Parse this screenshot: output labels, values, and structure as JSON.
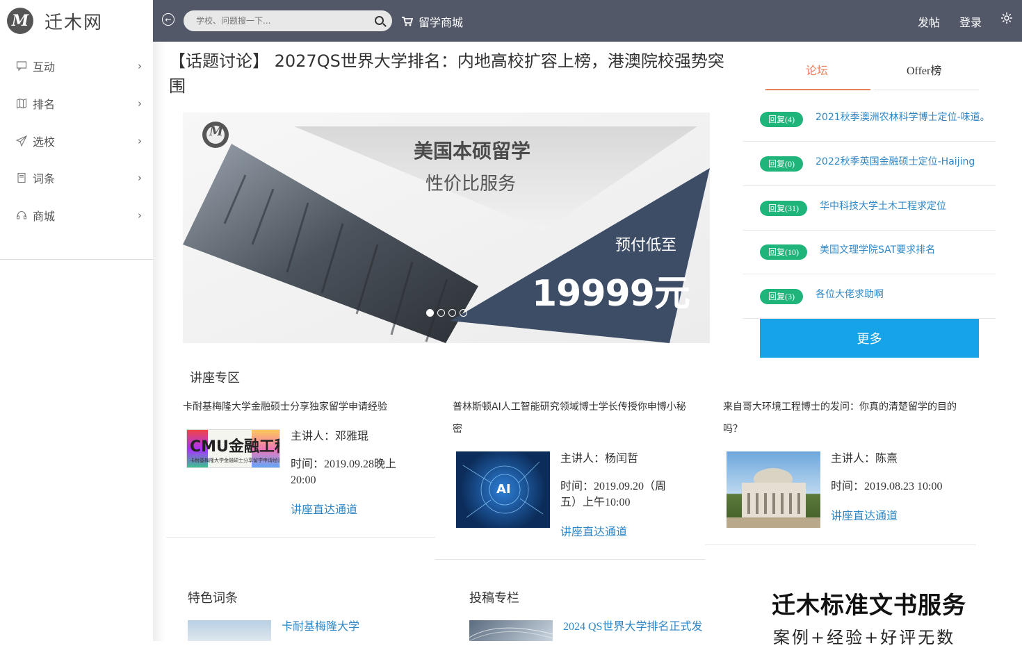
{
  "brand": {
    "logo_letter": "M",
    "name": "迁木网"
  },
  "sidebar": {
    "items": [
      {
        "label": "互动",
        "icon": "chat-icon"
      },
      {
        "label": "排名",
        "icon": "map-icon"
      },
      {
        "label": "选校",
        "icon": "send-icon"
      },
      {
        "label": "词条",
        "icon": "book-icon"
      },
      {
        "label": "商城",
        "icon": "headset-icon"
      }
    ],
    "arrow": "›"
  },
  "topbar": {
    "search_placeholder": "学校、问题搜一下...",
    "shop_label": "留学商城",
    "post_label": "发帖",
    "login_label": "登录"
  },
  "article": {
    "title": "【话题讨论】 2027QS世界大学排名：内地高校扩容上榜，港澳院校强势突围"
  },
  "banner": {
    "logo_letter": "M",
    "headline": "美国本硕留学",
    "subhead": "性价比服务",
    "price_label": "预付低至",
    "price": "19999元",
    "slides": 4,
    "active_slide": 1
  },
  "lectures": {
    "section_title": "讲座专区",
    "items": [
      {
        "title": "卡耐基梅隆大学金融硕士分享独家留学申请经验",
        "image_text": "CMU金融工程",
        "image_caption": "卡耐基梅隆大学金融硕士分享留学申请经验",
        "speaker": "主讲人：邓雅琨",
        "time": "时间：2019.09.28晚上20:00",
        "link": "讲座直达通道"
      },
      {
        "title": "普林斯顿AI人工智能研究领域博士学长传授你申博小秘密",
        "image_text": "AI",
        "speaker": "主讲人：杨闰哲",
        "time": "时间：2019.09.20（周五）上午10:00",
        "link": "讲座直达通道"
      },
      {
        "title": "来自哥大环境工程博士的发问：你真的清楚留学的目的吗？",
        "speaker": "主讲人：陈熹",
        "time": "时间：2019.08.23 10:00",
        "link": "讲座直达通道"
      }
    ]
  },
  "forum": {
    "tabs": [
      "论坛",
      "Offer榜"
    ],
    "posts": [
      {
        "badge": "回复(4)",
        "title": "2021秋季澳洲农林科学博士定位-味道。"
      },
      {
        "badge": "回复(0)",
        "title": "2022秋季英国金融硕士定位-Haijing"
      },
      {
        "badge": "回复(31)",
        "title": "华中科技大学土木工程求定位"
      },
      {
        "badge": "回复(10)",
        "title": "美国文理学院SAT要求排名"
      },
      {
        "badge": "回复(3)",
        "title": "各位大佬求助啊"
      }
    ],
    "more_label": "更多"
  },
  "featured_terms": {
    "section_title": "特色词条",
    "first_link": "卡耐基梅隆大学"
  },
  "contributions": {
    "section_title": "投稿专栏",
    "first_link": "2024 QS世界大学排名正式发"
  },
  "ad": {
    "title": "迁木标准文书服务",
    "subtitle": "案例+经验+好评无数"
  },
  "colors": {
    "topbar": "#525868",
    "accent": "#e8805a",
    "link": "#2f87c6",
    "badge": "#1fb57a",
    "more_button": "#16a3e8"
  }
}
